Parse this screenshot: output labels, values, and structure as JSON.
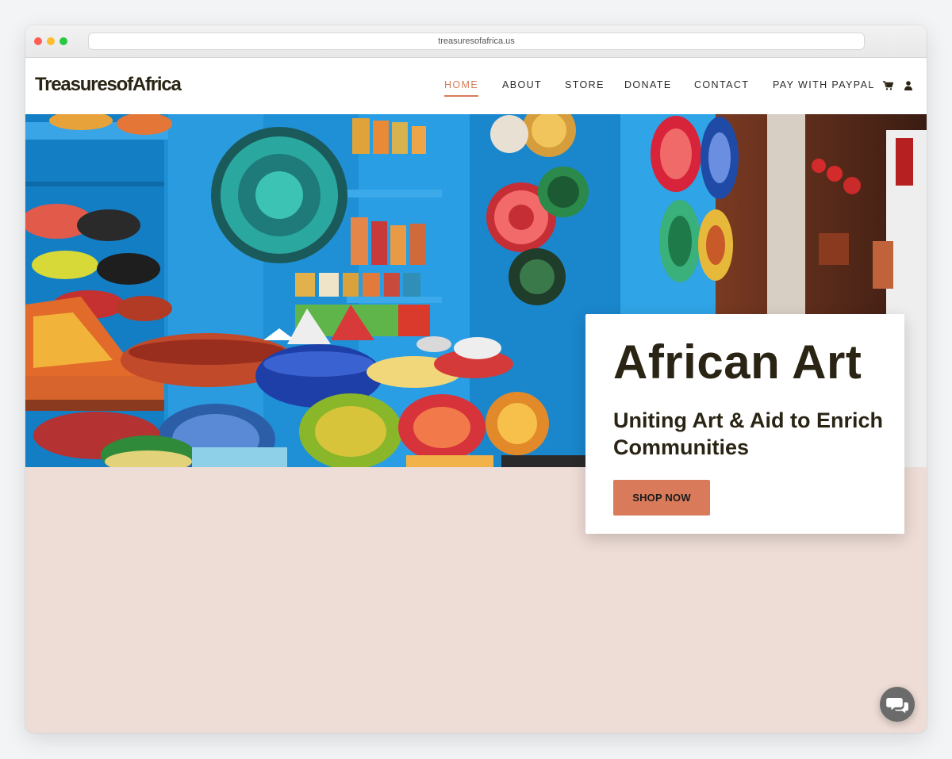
{
  "browser": {
    "url": "treasuresofafrica.us"
  },
  "header": {
    "logo": "TreasuresofAfrica",
    "nav": [
      {
        "label": "HOME",
        "active": true
      },
      {
        "label": "ABOUT"
      },
      {
        "label": "STORE"
      },
      {
        "label": "DONATE"
      },
      {
        "label": "CONTACT"
      },
      {
        "label": "PAY WITH PAYPAL"
      }
    ],
    "icons": [
      "cart-icon",
      "user-icon"
    ]
  },
  "hero": {
    "image": "colorful-pottery-shop-photo",
    "title": "African Art",
    "subtitle": "Uniting Art & Aid to Enrich Communities",
    "cta": "SHOP NOW"
  },
  "chat": {
    "icon": "chat-bubbles-icon"
  },
  "colors": {
    "accent": "#d97b5a",
    "page_bg": "#eedcd6",
    "text_dark": "#2a2414"
  }
}
